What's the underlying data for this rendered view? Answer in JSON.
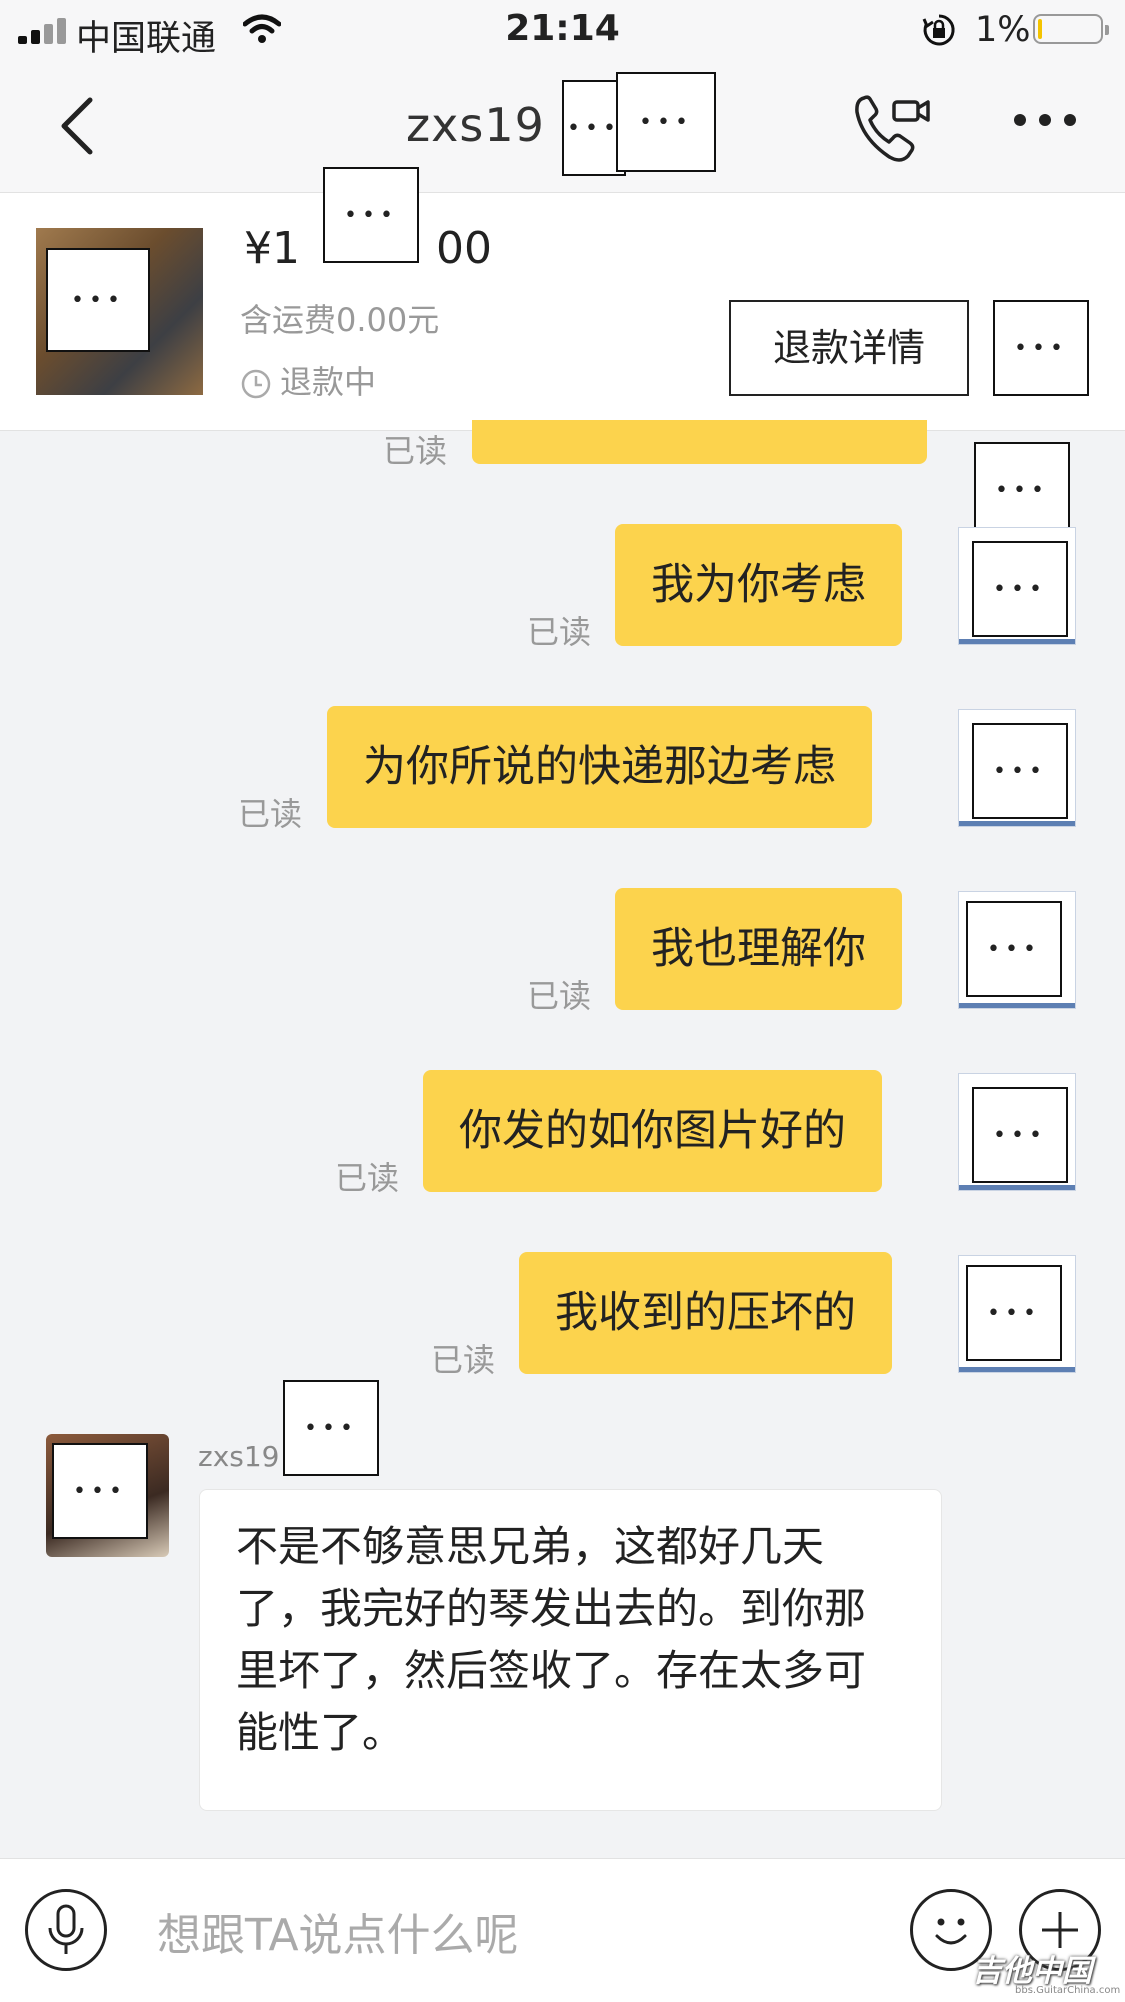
{
  "status_bar": {
    "carrier": "中国联通",
    "time": "21:14",
    "battery_text": "1%",
    "battery_level": 0.01,
    "icons": [
      "signal-icon",
      "wifi-icon",
      "rotation-lock-icon",
      "battery-icon"
    ]
  },
  "nav": {
    "title": "zxs19",
    "icons": [
      "back-icon",
      "call-video-icon",
      "more-icon"
    ]
  },
  "order": {
    "price_prefix": "¥1",
    "price_suffix": "00",
    "shipping": "含运费0.00元",
    "status": "退款中",
    "refund_button": "退款详情"
  },
  "messages": {
    "read_label": "已读",
    "sent": [
      {
        "text": "我为你考虑"
      },
      {
        "text": "为你所说的快递那边考虑"
      },
      {
        "text": "我也理解你"
      },
      {
        "text": "你发的如你图片好的"
      },
      {
        "text": "我收到的压坏的"
      }
    ],
    "received": {
      "sender": "zxs19",
      "text": "不是不够意思兄弟，这都好几天了，我完好的琴发出去的。到你那里坏了，然后签收了。存在太多可能性了。"
    }
  },
  "input": {
    "placeholder": "想跟TA说点什么呢"
  },
  "watermark": {
    "text": "吉他中国",
    "sub": "bbs.GuitarChina.com"
  },
  "colors": {
    "sent_bubble": "#fcd34d",
    "background": "#f2f3f5"
  }
}
